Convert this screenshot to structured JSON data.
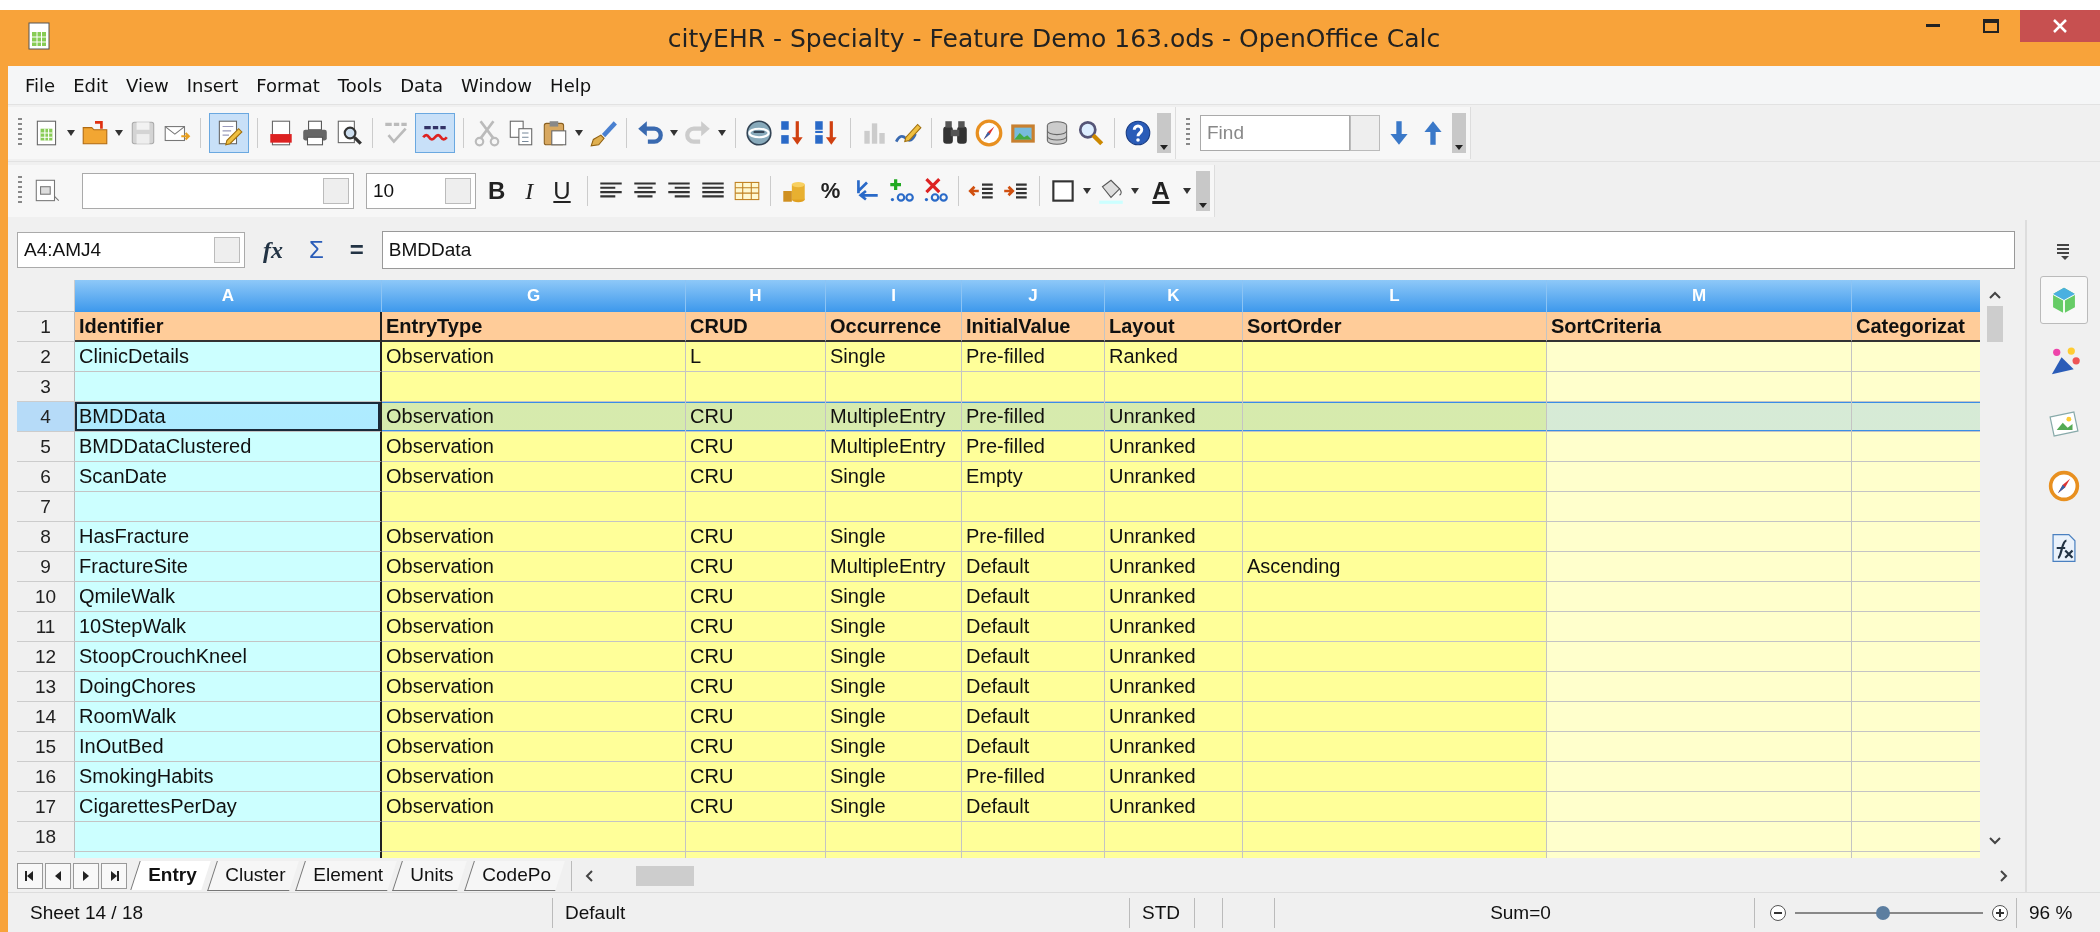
{
  "window": {
    "title": "cityEHR - Specialty - Feature Demo 163.ods - OpenOffice Calc"
  },
  "menu": [
    {
      "label": "File"
    },
    {
      "label": "Edit"
    },
    {
      "label": "View"
    },
    {
      "label": "Insert"
    },
    {
      "label": "Format"
    },
    {
      "label": "Tools"
    },
    {
      "label": "Data"
    },
    {
      "label": "Window"
    },
    {
      "label": "Help"
    }
  ],
  "toolbar": {
    "edit_mode": true,
    "auto_spellcheck": true,
    "find": {
      "placeholder": "Find"
    }
  },
  "format_toolbar": {
    "font_size": "10",
    "style_buttons": [
      "B",
      "I",
      "U"
    ],
    "percent_button": "%",
    "font_color_button": "A"
  },
  "formula_bar": {
    "name_box": "A4:AMJ4",
    "symbols": [
      "fx",
      "Σ",
      "="
    ],
    "content": "BMDData"
  },
  "sheet": {
    "columns": [
      {
        "letter": "A",
        "color": "#ccffff",
        "selected": true
      },
      {
        "letter": "G",
        "color": "#ffff99",
        "selected": true
      },
      {
        "letter": "H",
        "color": "#ffff99",
        "selected": true
      },
      {
        "letter": "I",
        "color": "#ffff99",
        "selected": true
      },
      {
        "letter": "J",
        "color": "#ffff99",
        "selected": true
      },
      {
        "letter": "K",
        "color": "#ffff99",
        "selected": true
      },
      {
        "letter": "L",
        "color": "#ffff99",
        "selected": true
      },
      {
        "letter": "M",
        "color": "#ffffcc",
        "selected": true
      },
      {
        "color": "#ffffcc",
        "selected": true
      }
    ],
    "rows": [
      {
        "num": "1",
        "kind": "header",
        "selected": false,
        "cursor": false,
        "cells": [
          "Identifier",
          "EntryType",
          "CRUD",
          "Occurrence",
          "InitialValue",
          "Layout",
          "SortOrder",
          "SortCriteria",
          "Categorizat"
        ]
      },
      {
        "num": "2",
        "selected": false,
        "cursor": false,
        "cells": [
          "ClinicDetails",
          "Observation",
          "L",
          "Single",
          "Pre-filled",
          "Ranked",
          "",
          "",
          ""
        ]
      },
      {
        "num": "3",
        "selected": false,
        "cursor": false,
        "cells": [
          "",
          "",
          "",
          "",
          "",
          "",
          "",
          "",
          ""
        ]
      },
      {
        "num": "4",
        "selected": true,
        "cursor": true,
        "cells": [
          "BMDData",
          "Observation",
          "CRU",
          "MultipleEntry",
          "Pre-filled",
          "Unranked",
          "",
          "",
          ""
        ]
      },
      {
        "num": "5",
        "selected": false,
        "cursor": false,
        "cells": [
          "BMDDataClustered",
          "Observation",
          "CRU",
          "MultipleEntry",
          "Pre-filled",
          "Unranked",
          "",
          "",
          ""
        ]
      },
      {
        "num": "6",
        "selected": false,
        "cursor": false,
        "cells": [
          "ScanDate",
          "Observation",
          "CRU",
          "Single",
          "Empty",
          "Unranked",
          "",
          "",
          ""
        ]
      },
      {
        "num": "7",
        "selected": false,
        "cursor": false,
        "cells": [
          "",
          "",
          "",
          "",
          "",
          "",
          "",
          "",
          ""
        ]
      },
      {
        "num": "8",
        "selected": false,
        "cursor": false,
        "cells": [
          "HasFracture",
          "Observation",
          "CRU",
          "Single",
          "Pre-filled",
          "Unranked",
          "",
          "",
          ""
        ]
      },
      {
        "num": "9",
        "selected": false,
        "cursor": false,
        "cells": [
          "FractureSite",
          "Observation",
          "CRU",
          "MultipleEntry",
          "Default",
          "Unranked",
          "Ascending",
          "",
          ""
        ]
      },
      {
        "num": "10",
        "selected": false,
        "cursor": false,
        "cells": [
          "QmileWalk",
          "Observation",
          "CRU",
          "Single",
          "Default",
          "Unranked",
          "",
          "",
          ""
        ]
      },
      {
        "num": "11",
        "selected": false,
        "cursor": false,
        "cells": [
          "10StepWalk",
          "Observation",
          "CRU",
          "Single",
          "Default",
          "Unranked",
          "",
          "",
          ""
        ]
      },
      {
        "num": "12",
        "selected": false,
        "cursor": false,
        "cells": [
          "StoopCrouchKneel",
          "Observation",
          "CRU",
          "Single",
          "Default",
          "Unranked",
          "",
          "",
          ""
        ]
      },
      {
        "num": "13",
        "selected": false,
        "cursor": false,
        "cells": [
          "DoingChores",
          "Observation",
          "CRU",
          "Single",
          "Default",
          "Unranked",
          "",
          "",
          ""
        ]
      },
      {
        "num": "14",
        "selected": false,
        "cursor": false,
        "cells": [
          "RoomWalk",
          "Observation",
          "CRU",
          "Single",
          "Default",
          "Unranked",
          "",
          "",
          ""
        ]
      },
      {
        "num": "15",
        "selected": false,
        "cursor": false,
        "cells": [
          "InOutBed",
          "Observation",
          "CRU",
          "Single",
          "Default",
          "Unranked",
          "",
          "",
          ""
        ]
      },
      {
        "num": "16",
        "selected": false,
        "cursor": false,
        "cells": [
          "SmokingHabits",
          "Observation",
          "CRU",
          "Single",
          "Pre-filled",
          "Unranked",
          "",
          "",
          ""
        ]
      },
      {
        "num": "17",
        "selected": false,
        "cursor": false,
        "cells": [
          "CigarettesPerDay",
          "Observation",
          "CRU",
          "Single",
          "Default",
          "Unranked",
          "",
          "",
          ""
        ]
      },
      {
        "num": "18",
        "selected": false,
        "cursor": false,
        "cells": [
          "",
          "",
          "",
          "",
          "",
          "",
          "",
          "",
          ""
        ]
      }
    ]
  },
  "sheet_tabs": [
    {
      "label": "Entry",
      "selected": true
    },
    {
      "label": "Cluster",
      "selected": false
    },
    {
      "label": "Element",
      "selected": false
    },
    {
      "label": "Units",
      "selected": false
    },
    {
      "label": "CodePo",
      "selected": false
    }
  ],
  "sidebar": {
    "decks": [
      {
        "selected": true
      },
      {
        "selected": false
      },
      {
        "selected": false
      },
      {
        "selected": false
      },
      {
        "selected": false
      }
    ]
  },
  "status_bar": {
    "sheet": "Sheet 14 / 18",
    "page_style": "Default",
    "selection_mode": "STD",
    "sum": "Sum=0",
    "zoom": {
      "level": 0.47,
      "reading": "96 %"
    }
  }
}
